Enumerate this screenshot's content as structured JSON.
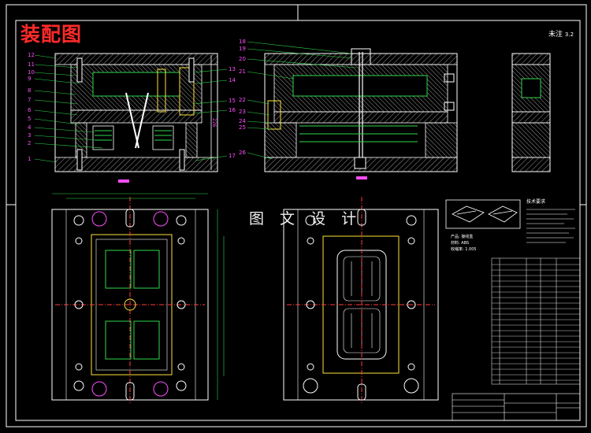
{
  "drawing": {
    "title": "装配图",
    "watermark": "图 文 设 计",
    "roughness_note": "未注",
    "roughness_value": "3.2"
  },
  "section_view_left": {
    "balloons_left": [
      "12",
      "11",
      "10",
      "9",
      "8",
      "7",
      "6",
      "5",
      "4",
      "3",
      "2",
      "1"
    ],
    "balloons_right": [
      "13",
      "14",
      "15",
      "16",
      "17"
    ]
  },
  "section_view_right": {
    "balloons_left": [
      "18",
      "19",
      "20",
      "21",
      "22",
      "23",
      "24",
      "25",
      "26"
    ]
  },
  "notes_block": {
    "header": "技术要求",
    "product_lines": [
      "产品: 接线盒",
      "材料: ABS",
      "收缩率: 1.005"
    ]
  },
  "colors": {
    "background": "#000000",
    "line_white": "#ffffff",
    "line_red": "#ff3b3b",
    "line_green": "#2fd84a",
    "line_magenta": "#ff4dff",
    "line_yellow": "#ffe23a",
    "line_cyan": "#3fd6ff"
  }
}
